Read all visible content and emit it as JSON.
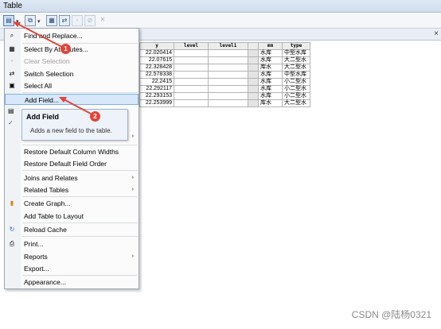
{
  "window": {
    "title": "Table"
  },
  "menu": {
    "items": [
      {
        "label": "Find and Replace...",
        "icon": "binoculars-icon",
        "glyph": "⌕",
        "disabled": false
      },
      {
        "label": "Select By Attributes...",
        "icon": "select-attr-icon",
        "glyph": "▦",
        "disabled": false
      },
      {
        "label": "Clear Selection",
        "icon": "clear-selection-icon",
        "glyph": "▫",
        "disabled": true
      },
      {
        "label": "Switch Selection",
        "icon": "switch-selection-icon",
        "glyph": "⇄",
        "disabled": false
      },
      {
        "label": "Select All",
        "icon": "select-all-icon",
        "glyph": "▣",
        "disabled": false
      },
      {
        "label": "Add Field...",
        "icon": "",
        "glyph": "",
        "disabled": false,
        "highlighted": true
      },
      {
        "label": "Restore Default Column Widths",
        "disabled": false
      },
      {
        "label": "Restore Default Field Order",
        "disabled": false
      },
      {
        "label": "Joins and Relates",
        "submenu": true
      },
      {
        "label": "Related Tables",
        "submenu": true
      },
      {
        "label": "Create Graph...",
        "icon": "graph-icon",
        "glyph": "▮"
      },
      {
        "label": "Add Table to Layout"
      },
      {
        "label": "Reload Cache",
        "icon": "reload-icon",
        "glyph": "↻"
      },
      {
        "label": "Print...",
        "icon": "printer-icon",
        "glyph": "⎙"
      },
      {
        "label": "Reports",
        "submenu": true
      },
      {
        "label": "Export..."
      },
      {
        "label": "Appearance..."
      }
    ],
    "submenu_arrow": "›"
  },
  "tooltip": {
    "title": "Add Field",
    "description": "Adds a new field to the table."
  },
  "annotations": [
    "1",
    "2"
  ],
  "table": {
    "headers": [
      "y",
      "level",
      "level1",
      "",
      "mm",
      "type"
    ],
    "rows": [
      [
        "22.020414",
        "",
        "",
        "",
        "水库",
        "中型水库"
      ],
      [
        "22.07615",
        "",
        "",
        "",
        "水库",
        "大二型水"
      ],
      [
        "22.328428",
        "",
        "",
        "",
        "库水",
        "大二型水"
      ],
      [
        "22.578338",
        "",
        "",
        "",
        "水库",
        "中型水库"
      ],
      [
        "22.2415",
        "",
        "",
        "",
        "水库",
        "小二型水"
      ],
      [
        "22.292117",
        "",
        "",
        "",
        "水库",
        "小二型水"
      ],
      [
        "22.293153",
        "",
        "",
        "",
        "水库",
        "小二型水"
      ],
      [
        "22.253999",
        "",
        "",
        "",
        "库水",
        "大二型水"
      ]
    ]
  },
  "watermark": "CSDN @陆杨0321",
  "close_glyph": "×",
  "check_glyph": "✓",
  "accent": "#e0453a"
}
